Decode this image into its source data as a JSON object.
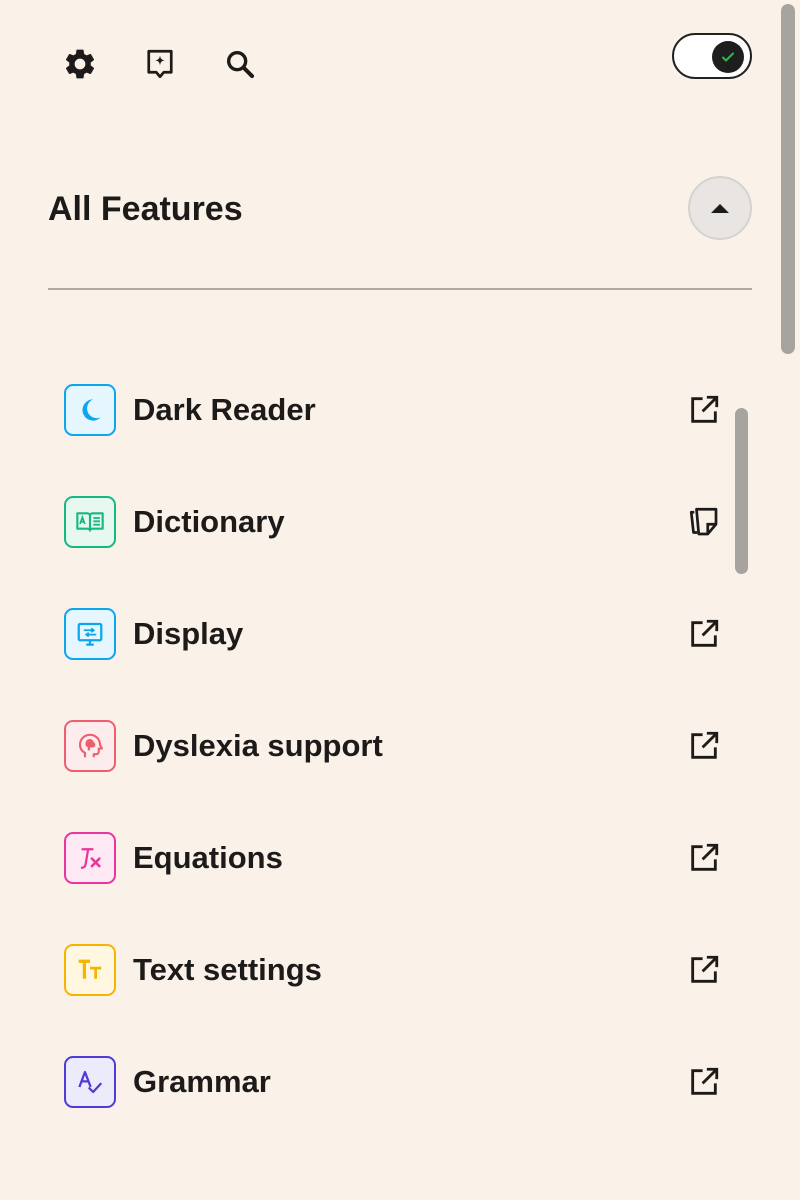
{
  "toolbar": {
    "settings_icon": "gear-icon",
    "ai_icon": "sparkle-note-icon",
    "search_icon": "search-icon",
    "toggle_on": true
  },
  "section": {
    "title": "All Features",
    "collapse_icon": "caret-up-icon"
  },
  "features": [
    {
      "label": "Dark Reader",
      "icon": "moon-icon",
      "action": "open-external-icon",
      "color": "#0aa6ee",
      "bg": "#e6f6fe"
    },
    {
      "label": "Dictionary",
      "icon": "book-icon",
      "action": "copy-icon",
      "color": "#15b981",
      "bg": "#e6f8f0"
    },
    {
      "label": "Display",
      "icon": "monitor-icon",
      "action": "open-external-icon",
      "color": "#0aa6ee",
      "bg": "#e6f6fe"
    },
    {
      "label": "Dyslexia support",
      "icon": "head-brain-icon",
      "action": "open-external-icon",
      "color": "#ee5f6e",
      "bg": "#fdecee"
    },
    {
      "label": "Equations",
      "icon": "math-function-icon",
      "action": "open-external-icon",
      "color": "#e9359d",
      "bg": "#fde8f3"
    },
    {
      "label": "Text settings",
      "icon": "text-size-icon",
      "action": "open-external-icon",
      "color": "#f5b400",
      "bg": "#fff7e0"
    },
    {
      "label": "Grammar",
      "icon": "spell-check-icon",
      "action": "open-external-icon",
      "color": "#4f3bd6",
      "bg": "#ecebfb"
    }
  ]
}
